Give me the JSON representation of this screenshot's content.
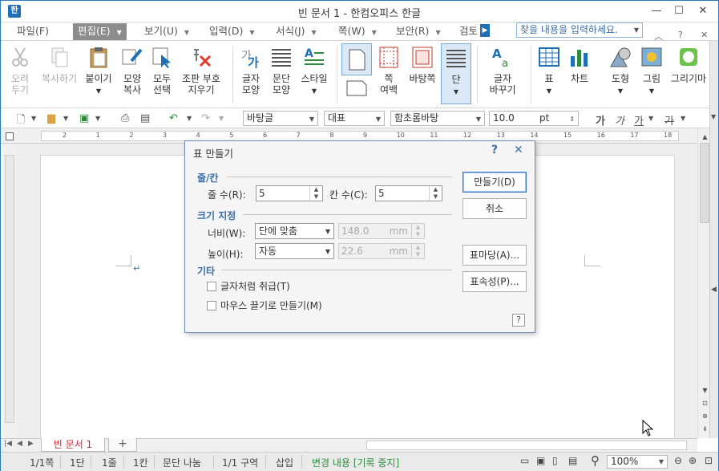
{
  "window": {
    "title": "빈 문서 1 - 한컴오피스 한글",
    "app_icon": "한"
  },
  "menus": [
    {
      "label": "파일(F)",
      "active": false
    },
    {
      "label": "편집(E)",
      "active": true
    },
    {
      "label": "보기(U)",
      "active": false
    },
    {
      "label": "입력(D)",
      "active": false
    },
    {
      "label": "서식(J)",
      "active": false
    },
    {
      "label": "쪽(W)",
      "active": false
    },
    {
      "label": "보안(R)",
      "active": false
    },
    {
      "label": "검토",
      "active": false
    }
  ],
  "search": {
    "placeholder": "찾을 내용을 입력하세요."
  },
  "ribbon": {
    "cut": "오려\n두기",
    "copy": "복사하기",
    "paste": "붙이기",
    "format_copy": "모양\n복사",
    "select_all": "모두\n선택",
    "delete_symbol": "조판 부호\n지우기",
    "char_shape": "글자\n모양",
    "para_shape": "문단\n모양",
    "style": "스타일",
    "page_margin": "쪽\n여백",
    "page_bg": "바탕쪽",
    "column": "단",
    "char_change": "글자\n바꾸기",
    "table": "표",
    "chart": "차트",
    "shape": "도형",
    "picture": "그림",
    "draw": "그리기마"
  },
  "format_bar": {
    "style": "바탕글",
    "lang": "대표",
    "font": "함초롬바탕",
    "size": "10.0",
    "unit": "pt",
    "bold": "가",
    "italic": "가",
    "underline": "가",
    "strike": "가"
  },
  "ruler": {
    "numbers": [
      "2",
      "1",
      "2",
      "3",
      "4",
      "5",
      "6",
      "7",
      "8",
      "9",
      "10",
      "11",
      "12",
      "13",
      "14",
      "15",
      "16",
      "17",
      "18"
    ]
  },
  "dialog": {
    "title": "표 만들기",
    "help_mark": "?",
    "close": "✕",
    "group_rowcol": "줄/칸",
    "rows_label": "줄 수(R):",
    "rows_value": "5",
    "cols_label": "칸 수(C):",
    "cols_value": "5",
    "group_size": "크기 지정",
    "width_label": "너비(W):",
    "width_mode": "단에 맞춤",
    "width_value": "148.0",
    "width_unit": "mm",
    "height_label": "높이(H):",
    "height_mode": "자동",
    "height_value": "22.6",
    "height_unit": "mm",
    "group_etc": "기타",
    "opt_char": "글자처럼 취급(T)",
    "opt_mouse": "마우스 끌기로 만들기(M)",
    "btn_create": "만들기(D)",
    "btn_cancel": "취소",
    "btn_table_template": "표마당(A)...",
    "btn_table_props": "표속성(P)...",
    "help_box": "?"
  },
  "tabs": {
    "doc": "빈 문서 1",
    "add": "+"
  },
  "status": {
    "page": "1/1쪽",
    "column": "1단",
    "line": "1줄",
    "col": "1칸",
    "para_break": "문단 나눔",
    "section": "1/1 구역",
    "insert": "삽입",
    "change": "변경 내용 [기록 중지]",
    "zoom": "100%"
  },
  "colors": {
    "accent": "#3a6ea5",
    "tab_text": "#cc2233",
    "status_green": "#2e8b3e"
  }
}
